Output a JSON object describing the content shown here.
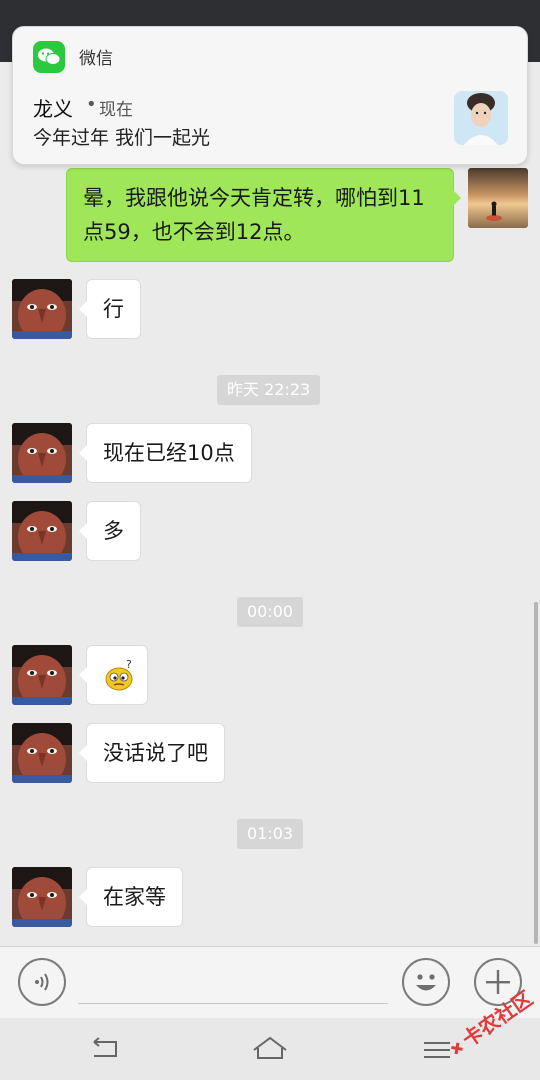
{
  "notification": {
    "app_name": "微信",
    "sender": "龙义",
    "separator": "•",
    "time": "现在",
    "message": "今年过年 我们一起光"
  },
  "messages": {
    "m1": "晕，我跟他说今天肯定转，哪怕到11点59，也不会到12点。",
    "m2": "行",
    "m3": "现在已经10点",
    "m4": "多",
    "m6": "没话说了吧",
    "m7": "在家等"
  },
  "timestamps": {
    "t1": "昨天 22:23",
    "t2": "00:00",
    "t3": "01:03"
  },
  "icons": {
    "voice": "voice-icon",
    "emoji": "emoji-icon",
    "plus": "plus-icon",
    "back": "back-icon",
    "home": "home-icon",
    "menu": "menu-icon"
  },
  "colors": {
    "sent_bubble": "#9fe658",
    "received_bubble": "#ffffff",
    "wechat_green": "#2bc840"
  },
  "watermark": "卡农社区"
}
